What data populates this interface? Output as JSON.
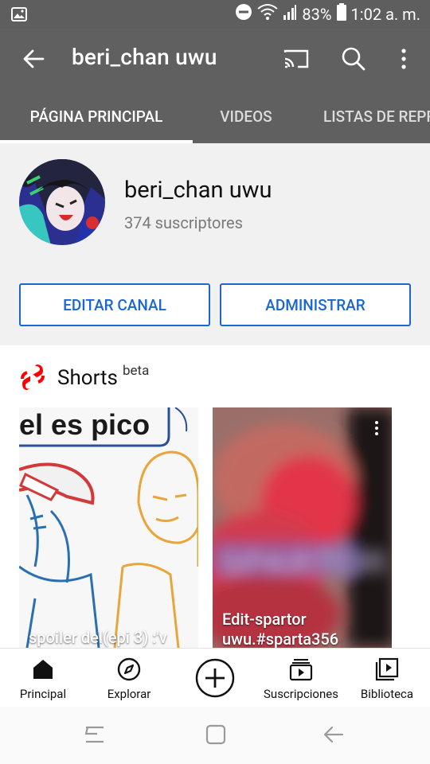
{
  "status_bar": {
    "battery": "83%",
    "time": "1:02 a. m."
  },
  "app_bar": {
    "title": "beri_chan uwu"
  },
  "tabs": [
    {
      "label": "PÁGINA PRINCIPAL",
      "active": true
    },
    {
      "label": "VIDEOS",
      "active": false
    },
    {
      "label": "LISTAS DE REPRODUCCIÓN",
      "active": false
    }
  ],
  "channel": {
    "name": "beri_chan uwu",
    "subscribers": "374 suscriptores",
    "edit_button": "EDITAR CANAL",
    "manage_button": "ADMINISTRAR"
  },
  "shorts": {
    "title": "Shorts",
    "badge": "beta",
    "items": [
      {
        "overlay_text": "el es pico",
        "caption": "spoiler del(epi 3) :'v"
      },
      {
        "caption_line1": "Edit-spartor",
        "caption_line2": "uwu.#sparta356",
        "watermark": "SPARTOR"
      }
    ]
  },
  "bottom_nav": [
    {
      "label": "Principal",
      "icon": "home-icon"
    },
    {
      "label": "Explorar",
      "icon": "explore-icon"
    },
    {
      "label": "",
      "icon": "create-icon"
    },
    {
      "label": "Suscripciones",
      "icon": "subscriptions-icon"
    },
    {
      "label": "Biblioteca",
      "icon": "library-icon"
    }
  ],
  "colors": {
    "app_bar": "#606060",
    "status_bar": "#5e5e5e",
    "accent_blue": "#1a67d2",
    "shorts_red": "#ff0000"
  }
}
